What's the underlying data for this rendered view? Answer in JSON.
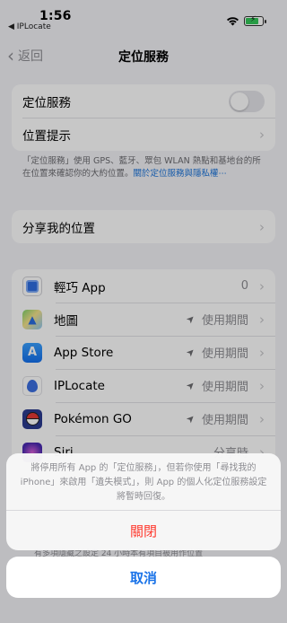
{
  "status_bar": {
    "time": "1:56",
    "back_app": "◀ IPLocate",
    "battery_color": "#34c759",
    "icons": [
      "wifi-icon",
      "battery-charging-icon"
    ]
  },
  "nav": {
    "back_label": "返回",
    "title": "定位服務"
  },
  "location_group": {
    "toggle_label": "定位服務",
    "toggle_on": false,
    "alerts_label": "位置提示"
  },
  "footnote": {
    "text": "「定位服務」使用 GPS、藍牙、眾包 WLAN 熱點和基地台的所在位置來確認你的大約位置。",
    "link": "關於定位服務與隱私權⋯"
  },
  "share": {
    "label": "分享我的位置"
  },
  "apps": [
    {
      "name": "輕巧 App",
      "status": "0",
      "show_arrow": false,
      "icon": "qinqiao-app-icon"
    },
    {
      "name": "地圖",
      "status": "使用期間",
      "show_arrow": true,
      "icon": "maps-icon"
    },
    {
      "name": "App Store",
      "status": "使用期間",
      "show_arrow": true,
      "icon": "app-store-icon"
    },
    {
      "name": "IPLocate",
      "status": "使用期間",
      "show_arrow": true,
      "icon": "iplocate-icon"
    },
    {
      "name": "Pokémon GO",
      "status": "使用期間",
      "show_arrow": true,
      "icon": "pokemon-go-icon"
    },
    {
      "name": "Siri",
      "status": "分享時",
      "show_arrow": false,
      "icon": "siri-icon"
    }
  ],
  "action_sheet": {
    "message": "將停用所有 App 的「定位服務」，但若你使用「尋找我的iPhone」來啟用「遺失模式」，則 App 的個人化定位服務設定將暫時回復。",
    "destructive_label": "關閉",
    "cancel_label": "取消",
    "destructive_color": "#ff3b30",
    "cancel_color": "#1a73e8"
  },
  "background_peek_text": "有多項隱藏之設定 24 小時本有項目被用作位置"
}
